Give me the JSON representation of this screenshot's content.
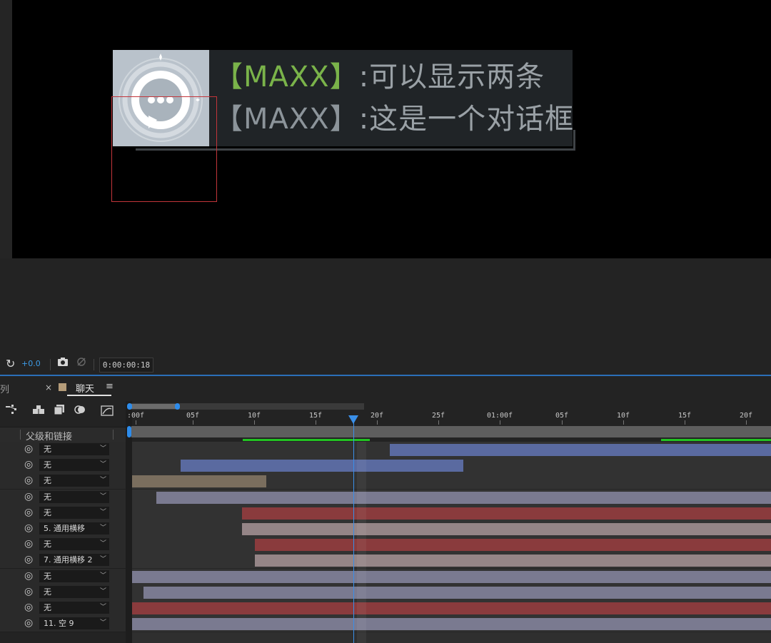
{
  "viewer": {
    "dialog": {
      "line1": {
        "name": "【MAXX】",
        "text": ":可以显示两条"
      },
      "line2": {
        "name": "【MAXX】",
        "text": ":这是一个对话框"
      }
    }
  },
  "viewer_toolbar": {
    "exposure_icon": "exposure-icon",
    "exposure_value": "+0.0",
    "timecode": "0:00:00:18"
  },
  "timeline": {
    "tab_queue_label": "队列",
    "tab_close": "×",
    "tab_comp_label": "聊天",
    "tab_menu": "≡",
    "column_parent_label": "父级和链接",
    "time_ticks": [
      ":00f",
      "05f",
      "10f",
      "15f",
      "20f",
      "25f",
      "01:00f",
      "05f",
      "10f",
      "15f",
      "20f"
    ],
    "layers": [
      {
        "parent": "无",
        "bar_color": "#5a6aa0"
      },
      {
        "parent": "无",
        "bar_color": "#5a6aa0"
      },
      {
        "parent": "无",
        "bar_color": "#7a6e5e"
      },
      {
        "parent": "无",
        "bar_color": "#7a7a90"
      },
      {
        "parent": "无",
        "bar_color": "#8a3b3d"
      },
      {
        "parent": "5. 通用横移",
        "bar_color": "#958587"
      },
      {
        "parent": "无",
        "bar_color": "#8a3b3d"
      },
      {
        "parent": "7. 通用横移 2",
        "bar_color": "#958587"
      },
      {
        "parent": "无",
        "bar_color": "#7a7a90"
      },
      {
        "parent": "无",
        "bar_color": "#7a7a90"
      },
      {
        "parent": "无",
        "bar_color": "#8a3b3d"
      },
      {
        "parent": "11. 空 9",
        "bar_color": "#7a7a90"
      }
    ]
  }
}
